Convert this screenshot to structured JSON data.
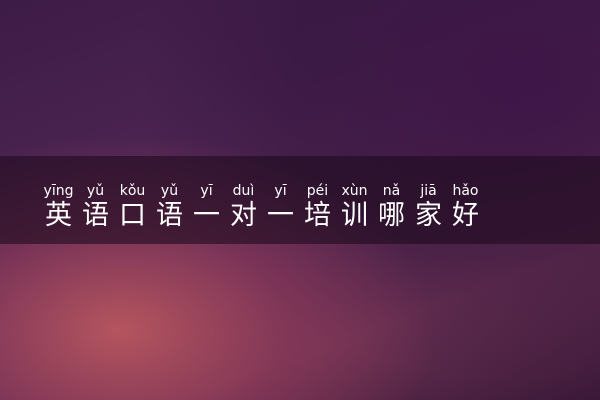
{
  "title": {
    "pinyin": [
      "yīng",
      "yǔ",
      "kǒu",
      "yǔ",
      "yī",
      "duì",
      "yī",
      "péi",
      "xùn",
      "nǎ",
      "jiā",
      "hǎo"
    ],
    "characters": [
      "英",
      "语",
      "口",
      "语",
      "一",
      "对",
      "一",
      "培",
      "训",
      "哪",
      "家",
      "好"
    ]
  },
  "colors": {
    "text": "#ffffff",
    "banner": "#1e0c1e",
    "background_dark": "#3d1c47",
    "background_glow": "#c45c60"
  }
}
